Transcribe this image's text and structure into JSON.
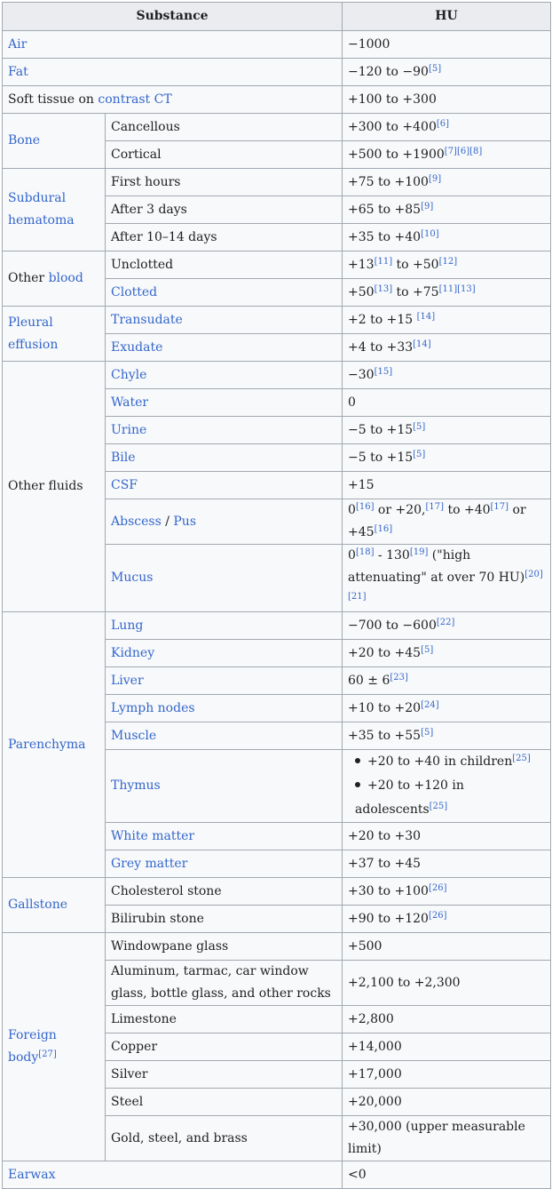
{
  "headers": {
    "substance": "Substance",
    "hu": "HU"
  },
  "air": {
    "label": "Air",
    "hu": "−1000"
  },
  "fat": {
    "label": "Fat",
    "hu": "−120 to −90",
    "ref": "[5]"
  },
  "soft_tissue": {
    "prefix": "Soft tissue on ",
    "link": "contrast CT",
    "hu": "+100 to +300"
  },
  "bone": {
    "label": "Bone",
    "rows": [
      {
        "name": "Cancellous",
        "hu": "+300 to +400",
        "ref": "[6]"
      },
      {
        "name": "Cortical",
        "hu": "+500 to +1900",
        "ref": "[7][6][8]"
      }
    ]
  },
  "subdural": {
    "label": "Subdural hematoma",
    "rows": [
      {
        "name": "First hours",
        "hu": "+75 to +100",
        "ref": "[9]"
      },
      {
        "name": "After 3 days",
        "hu": "+65 to +85",
        "ref": "[9]"
      },
      {
        "name": "After 10–14 days",
        "hu": "+35 to +40",
        "ref": "[10]"
      }
    ]
  },
  "blood": {
    "prefix": "Other ",
    "link": "blood",
    "unclotted": {
      "name": "Unclotted",
      "hu1": "+13",
      "ref1": "[11]",
      "hu2": " to +50",
      "ref2": "[12]"
    },
    "clotted": {
      "name": "Clotted",
      "hu1": "+50",
      "ref1": "[13]",
      "hu2": " to +75",
      "ref2": "[11][13]"
    }
  },
  "pleural": {
    "label": "Pleural effusion",
    "rows": [
      {
        "name": "Transudate",
        "hu": "+2 to +15 ",
        "ref": "[14]"
      },
      {
        "name": "Exudate",
        "hu": "+4 to +33",
        "ref": "[14]"
      }
    ]
  },
  "fluids": {
    "label": "Other fluids",
    "chyle": {
      "name": "Chyle",
      "hu": "−30",
      "ref": "[15]"
    },
    "water": {
      "name": "Water",
      "hu": "0"
    },
    "urine": {
      "name": "Urine",
      "hu": "−5 to +15",
      "ref": "[5]"
    },
    "bile": {
      "name": "Bile",
      "hu": "−5 to +15",
      "ref": "[5]"
    },
    "csf": {
      "name": "CSF",
      "hu": "+15"
    },
    "abscess": {
      "name1": "Abscess",
      "sep": " / ",
      "name2": "Pus",
      "t1": "0",
      "r1": "[16]",
      "t2": " or +20,",
      "r2": "[17]",
      "t3": " to +40",
      "r3": "[17]",
      "t4": " or +45",
      "r4": "[16]"
    },
    "mucus": {
      "name": "Mucus",
      "t1": "0",
      "r1": "[18]",
      "t2": " - 130",
      "r2": "[19]",
      "t3": " (\"high attenuating\" at over 70 HU)",
      "r3": "[20][21]"
    }
  },
  "parenchyma": {
    "label": "Parenchyma",
    "lung": {
      "name": "Lung",
      "hu": "−700 to −600",
      "ref": "[22]"
    },
    "kidney": {
      "name": "Kidney",
      "hu": "+20 to +45",
      "ref": "[5]"
    },
    "liver": {
      "name": "Liver",
      "hu": "60 ± 6",
      "ref": "[23]"
    },
    "lymph": {
      "name": "Lymph nodes",
      "hu": "+10 to +20",
      "ref": "[24]"
    },
    "muscle": {
      "name": "Muscle",
      "hu": "+35 to +55",
      "ref": "[5]"
    },
    "thymus": {
      "name": "Thymus",
      "b1": "+20 to +40 in children",
      "r1": "[25]",
      "b2": "+20 to +120 in adolescents",
      "r2": "[25]"
    },
    "white": {
      "name": "White matter",
      "hu": "+20 to +30"
    },
    "grey": {
      "name": "Grey matter",
      "hu": "+37 to +45"
    }
  },
  "gallstone": {
    "label": "Gallstone",
    "rows": [
      {
        "name": "Cholesterol stone",
        "hu": "+30 to +100",
        "ref": "[26]"
      },
      {
        "name": "Bilirubin stone",
        "hu": "+90 to +120",
        "ref": "[26]"
      }
    ]
  },
  "foreign": {
    "label": "Foreign body",
    "ref": "[27]",
    "rows": [
      {
        "name": "Windowpane glass",
        "hu": "+500"
      },
      {
        "name": "Aluminum, tarmac, car window glass, bottle glass, and other rocks",
        "hu": "+2,100 to +2,300"
      },
      {
        "name": "Limestone",
        "hu": "+2,800"
      },
      {
        "name": "Copper",
        "hu": "+14,000"
      },
      {
        "name": "Silver",
        "hu": "+17,000"
      },
      {
        "name": "Steel",
        "hu": "+20,000"
      },
      {
        "name": "Gold, steel, and brass",
        "hu": "+30,000 (upper measurable limit)"
      }
    ]
  },
  "earwax": {
    "label": "Earwax",
    "hu": "<0"
  }
}
